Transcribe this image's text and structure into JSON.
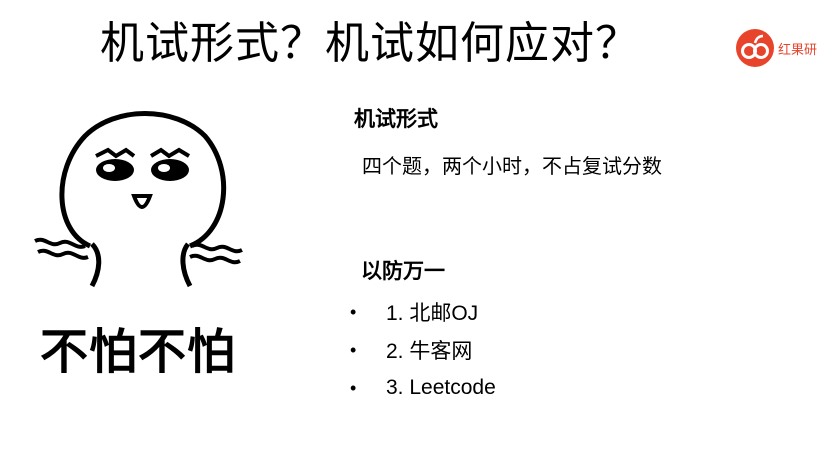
{
  "slide": {
    "title": "机试形式？机试如何应对？",
    "logo": {
      "text": "红果研",
      "icon": "orange-fruit-logo",
      "color": "#e8442c"
    },
    "meme": {
      "image": "smiling-doodle-character-icon",
      "caption": "不怕不怕"
    },
    "section1": {
      "heading": "机试形式",
      "text": "四个题，两个小时，不占复试分数"
    },
    "section2": {
      "heading": "以防万一",
      "items": [
        "1. 北邮OJ",
        "2. 牛客网",
        "3. Leetcode"
      ]
    }
  }
}
